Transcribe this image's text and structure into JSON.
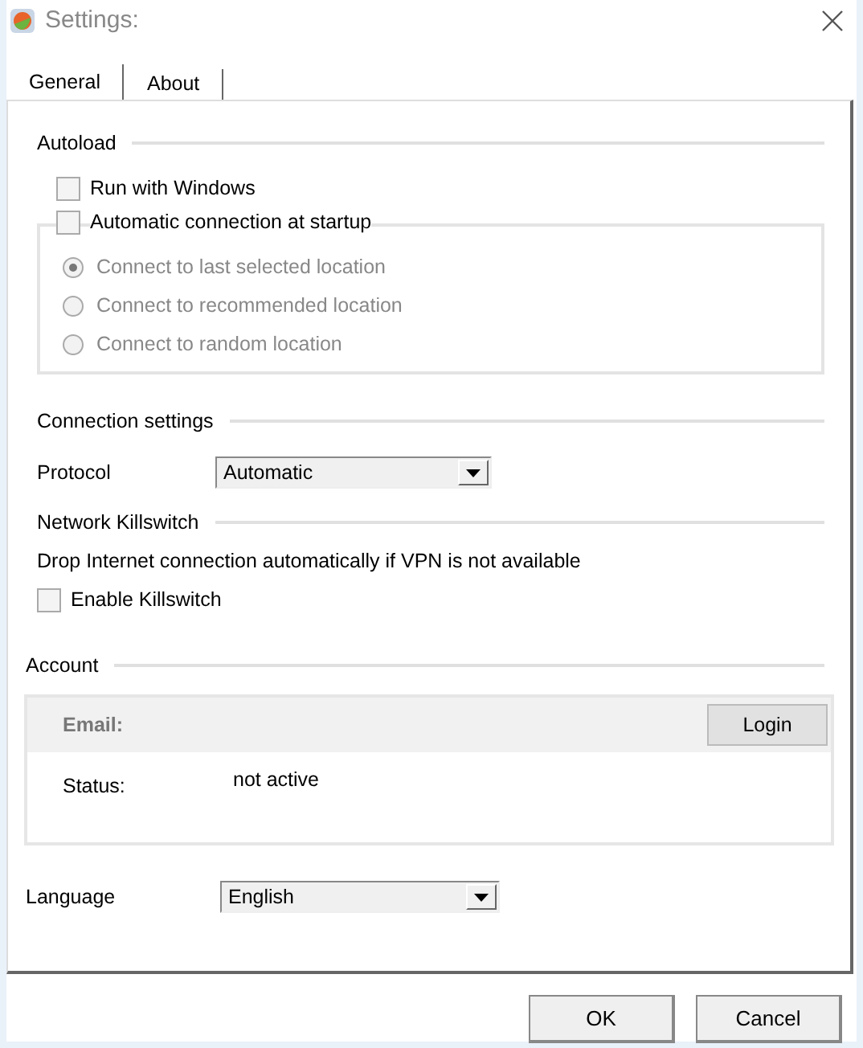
{
  "window": {
    "title": "Settings:"
  },
  "tabs": [
    {
      "label": "General",
      "selected": true
    },
    {
      "label": "About",
      "selected": false
    }
  ],
  "autoload": {
    "title": "Autoload",
    "run_with_windows": {
      "label": "Run with Windows",
      "checked": false
    },
    "auto_connect": {
      "label": "Automatic connection at startup",
      "checked": false
    },
    "locations": [
      {
        "label": "Connect to last selected location",
        "selected": true,
        "disabled": true
      },
      {
        "label": "Connect to recommended location",
        "selected": false,
        "disabled": true
      },
      {
        "label": "Connect to random location",
        "selected": false,
        "disabled": true
      }
    ]
  },
  "connection": {
    "title": "Connection settings",
    "protocol": {
      "label": "Protocol",
      "value": "Automatic"
    }
  },
  "killswitch": {
    "title": "Network Killswitch",
    "description": "Drop Internet connection automatically if VPN is not available",
    "enable": {
      "label": "Enable Killswitch",
      "checked": false
    }
  },
  "account": {
    "title": "Account",
    "email_label": "Email:",
    "login_button": "Login",
    "status_label": "Status:",
    "status_value": "not active"
  },
  "language": {
    "label": "Language",
    "value": "English"
  },
  "buttons": [
    "OK",
    "Cancel"
  ]
}
